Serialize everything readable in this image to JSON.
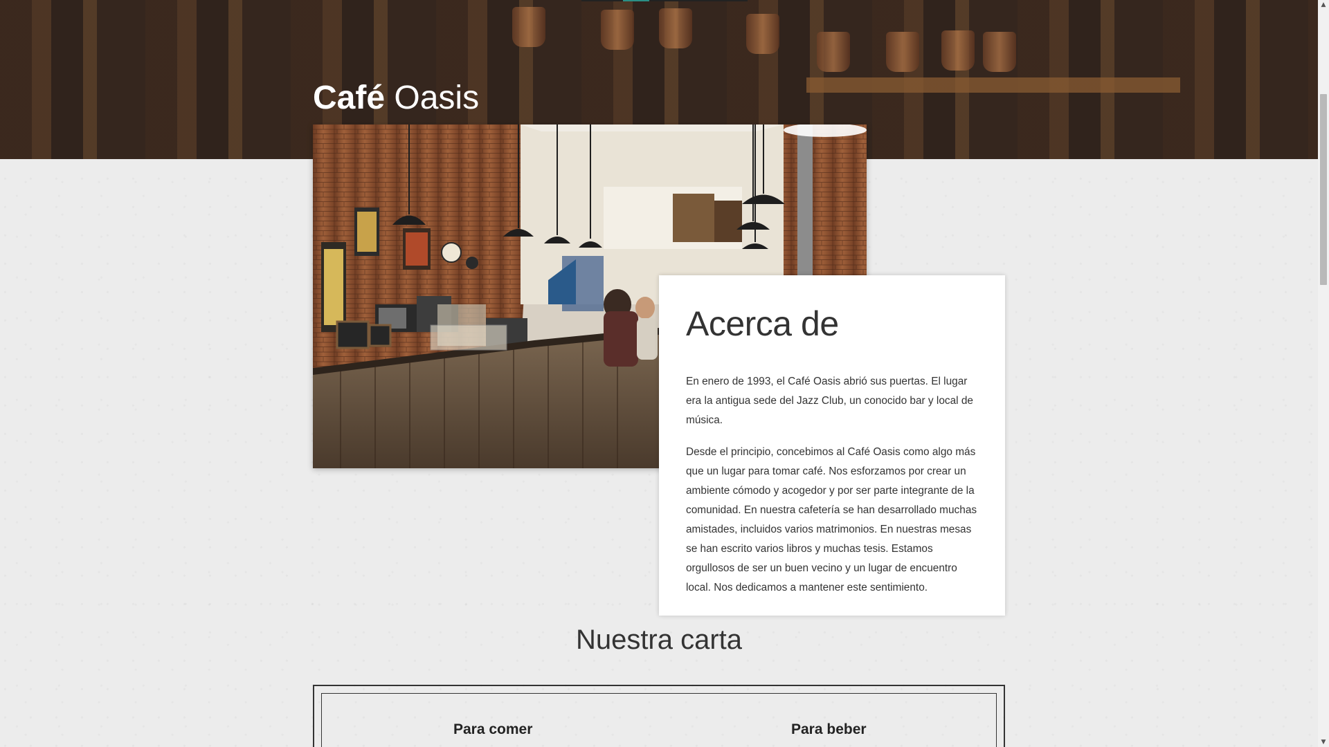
{
  "brand": {
    "part1": "Café",
    "part2": "Oasis"
  },
  "about": {
    "title": "Acerca de",
    "paragraphs": [
      "En enero de 1993, el Café Oasis abrió sus puertas. El lugar era la antigua sede del Jazz Club, un conocido bar y local de música.",
      "Desde el principio, concebimos al Café Oasis como algo más que un lugar para tomar café. Nos esforzamos por crear un ambiente cómodo y acogedor y por ser parte integrante de la comunidad. En nuestra cafetería se han desarrollado muchas amistades, incluidos varios matrimonios. En nuestras mesas se han escrito varios libros y muchas tesis. Estamos orgullosos de ser un buen vecino y un lugar de encuentro local. Nos dedicamos a mantener este sentimiento."
    ]
  },
  "menu": {
    "title": "Nuestra carta",
    "columns": [
      "Para comer",
      "Para beber"
    ]
  },
  "scrollbar": {
    "up_icon": "▲",
    "down_icon": "▼"
  },
  "colors": {
    "hero_overlay": "#3a2a22",
    "accent": "#2a8f86",
    "text": "#333333",
    "card": "#ffffff"
  }
}
